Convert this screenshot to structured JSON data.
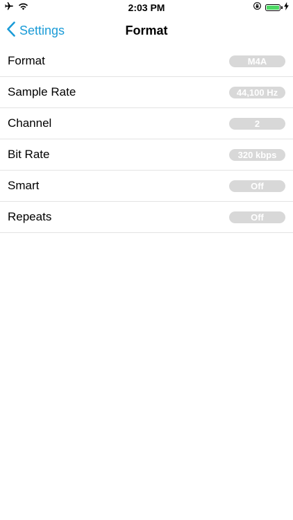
{
  "status_bar": {
    "time": "2:03 PM",
    "left_icons": [
      "airplane-icon",
      "wifi-icon"
    ],
    "right_icons": [
      "rotation-lock-icon",
      "battery-icon",
      "charging-icon"
    ],
    "battery_color": "#4cd964"
  },
  "nav": {
    "back_label": "Settings",
    "title": "Format",
    "accent_color": "#1a9bd7"
  },
  "rows": [
    {
      "label": "Format",
      "value": "M4A"
    },
    {
      "label": "Sample Rate",
      "value": "44,100 Hz"
    },
    {
      "label": "Channel",
      "value": "2"
    },
    {
      "label": "Bit Rate",
      "value": "320 kbps"
    },
    {
      "label": "Smart",
      "value": "Off"
    },
    {
      "label": "Repeats",
      "value": "Off"
    }
  ]
}
